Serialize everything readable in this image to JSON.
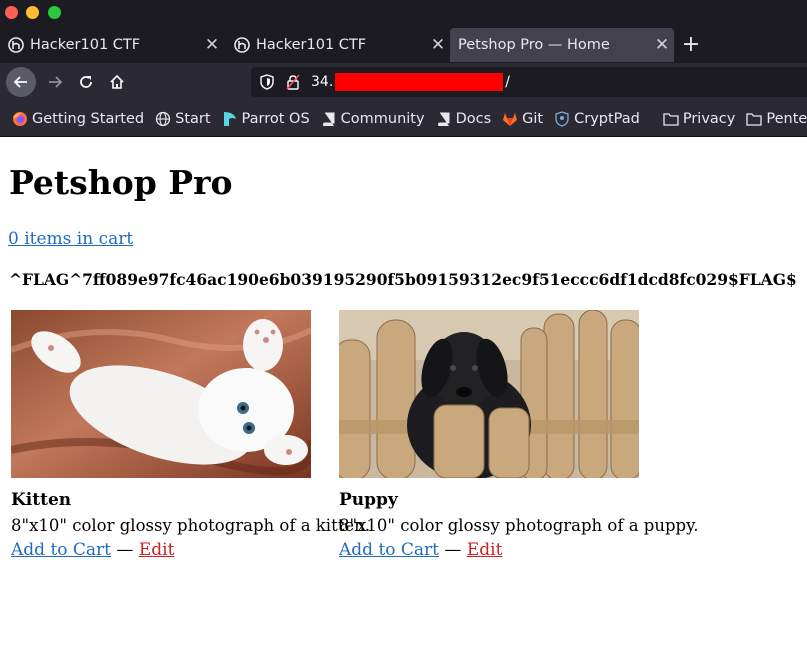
{
  "window": {
    "controls": [
      "close",
      "minimize",
      "maximize"
    ]
  },
  "tabs": [
    {
      "title": "Hacker101 CTF",
      "icon": "hacker101-icon",
      "active": false
    },
    {
      "title": "Hacker101 CTF",
      "icon": "hacker101-icon",
      "active": false
    },
    {
      "title": "Petshop Pro — Home",
      "icon": "",
      "active": true
    }
  ],
  "navbar": {
    "url_prefix": "34.",
    "url_suffix": "/"
  },
  "bookmarks": [
    {
      "label": "Getting Started",
      "icon": "firefox-icon"
    },
    {
      "label": "Start",
      "icon": "globe-icon"
    },
    {
      "label": "Parrot OS",
      "icon": "parrot-icon"
    },
    {
      "label": "Community",
      "icon": "book-icon"
    },
    {
      "label": "Docs",
      "icon": "book-icon"
    },
    {
      "label": "Git",
      "icon": "gitlab-icon"
    },
    {
      "label": "CryptPad",
      "icon": "cryptpad-icon"
    },
    {
      "label": "Privacy",
      "icon": "folder-icon"
    },
    {
      "label": "Pentest",
      "icon": "folder-icon"
    }
  ],
  "page": {
    "title": "Petshop Pro",
    "cart_link": "0 items in cart",
    "flag": "^FLAG^7ff089e97fc46ac190e6b039195290f5b09159312ec9f51eccc6df1dcd8fc029$FLAG$",
    "products": [
      {
        "name": "Kitten",
        "description": "8\"x10\" color glossy photograph of a kitten.",
        "add_label": "Add to Cart",
        "separator": " — ",
        "edit_label": "Edit"
      },
      {
        "name": "Puppy",
        "description": "8\"x10\" color glossy photograph of a puppy.",
        "add_label": "Add to Cart",
        "separator": " — ",
        "edit_label": "Edit"
      }
    ]
  },
  "colors": {
    "link": "#1f6bbf",
    "edit_link": "#d11e1e",
    "chrome_dark": "#1c1b22",
    "chrome": "#2b2a33",
    "redaction": "#ff0000"
  }
}
